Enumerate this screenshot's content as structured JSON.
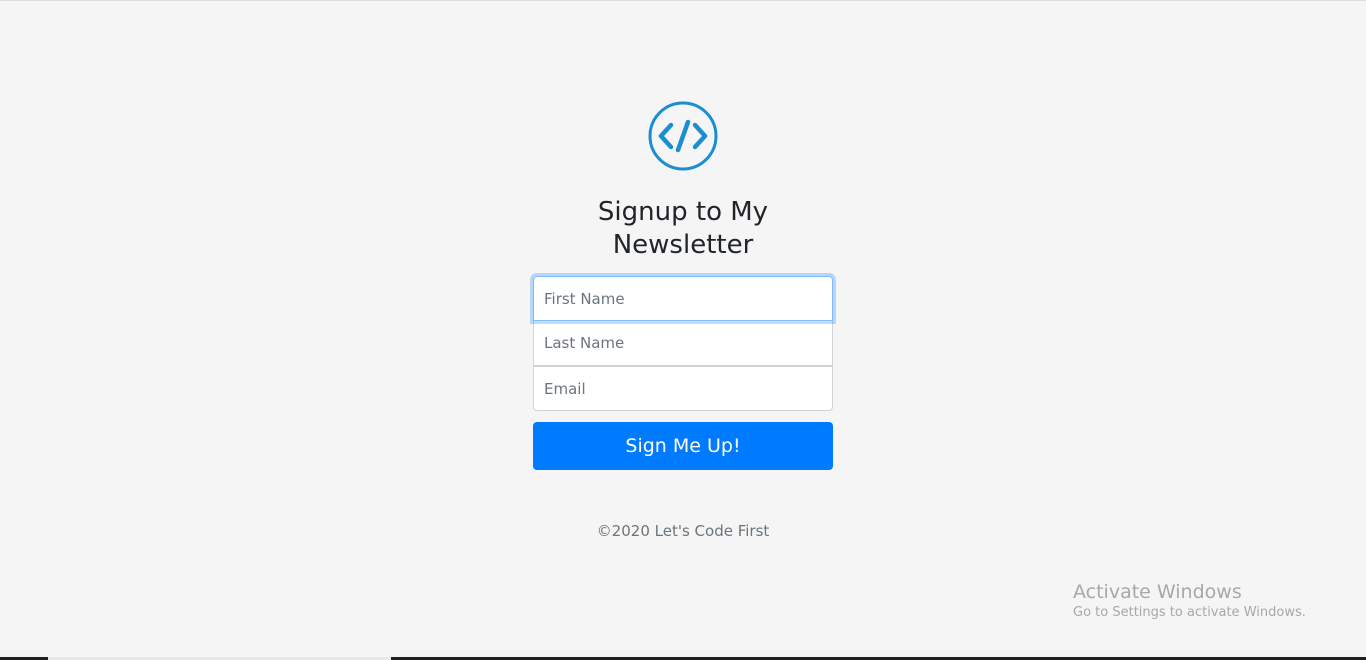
{
  "logo": {
    "icon": "code-brackets-icon",
    "color": "#1a8ed1"
  },
  "form": {
    "title": "Signup to My Newsletter",
    "first_name": {
      "placeholder": "First Name",
      "value": ""
    },
    "last_name": {
      "placeholder": "Last Name",
      "value": ""
    },
    "email": {
      "placeholder": "Email",
      "value": ""
    },
    "submit_label": "Sign Me Up!",
    "accent_color": "#007bff"
  },
  "footer": {
    "text": "©2020 Let's Code First"
  },
  "watermark": {
    "title": "Activate Windows",
    "subtitle": "Go to Settings to activate Windows."
  }
}
